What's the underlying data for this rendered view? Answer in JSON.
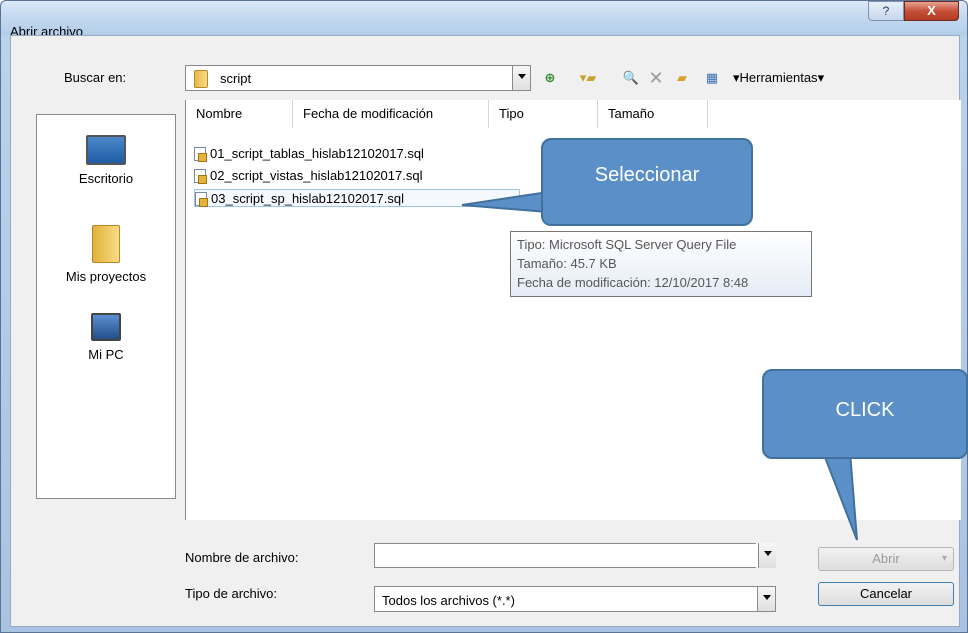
{
  "window": {
    "title": "Abrir archivo",
    "help": "?",
    "close": "X"
  },
  "lookin": {
    "label": "Buscar en:",
    "value": "script"
  },
  "toolbar": {
    "tools_label": "Herramientas"
  },
  "places": [
    {
      "label": "Escritorio"
    },
    {
      "label": "Mis proyectos"
    },
    {
      "label": "Mi PC"
    }
  ],
  "columns": [
    "Nombre",
    "Fecha de modificación",
    "Tipo",
    "Tamaño"
  ],
  "files": [
    "01_script_tablas_hislab12102017.sql",
    "02_script_vistas_hislab12102017.sql",
    "03_script_sp_hislab12102017.sql"
  ],
  "tooltip": {
    "type": "Tipo: Microsoft SQL Server Query File",
    "size": "Tamaño: 45.7 KB",
    "date": "Fecha de modificación: 12/10/2017 8:48"
  },
  "callouts": {
    "select": "Seleccionar",
    "click": "CLICK"
  },
  "filename": {
    "label": "Nombre de archivo:",
    "value": ""
  },
  "filetype": {
    "label": "Tipo de archivo:",
    "value": "Todos los archivos (*.*)"
  },
  "buttons": {
    "open": "Abrir",
    "cancel": "Cancelar"
  },
  "colors": {
    "callout": "#5b8fc7",
    "titlebar": "#c3d8f0"
  }
}
